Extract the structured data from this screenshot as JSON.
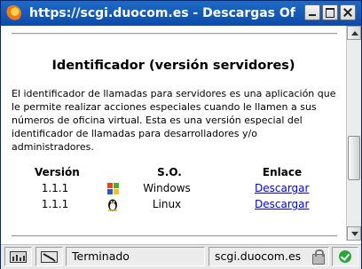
{
  "window": {
    "title": "https://scgi.duocom.es - Descargas Oficina Virtual"
  },
  "page": {
    "heading": "Identificador (versión servidores)",
    "description": "El identificador de llamadas para servidores es una aplicación que le permite realizar acciones especiales cuando le llamen a sus números de oficina virtual. Esta es una versión especial del identificador de llamadas para desarrolladores y/o administradores.",
    "table": {
      "headers": [
        "Versión",
        "S.O.",
        "Enlace"
      ],
      "rows": [
        {
          "version": "1.1.1",
          "os": "Windows",
          "os_icon": "windows-logo-icon",
          "link": "Descargar"
        },
        {
          "version": "1.1.1",
          "os": "Linux",
          "os_icon": "tux-penguin-icon",
          "link": "Descargar"
        }
      ]
    }
  },
  "status_bar": {
    "status_text": "Terminado",
    "host": "scgi.duocom.es",
    "icons": [
      "status-monitor-icon",
      "edit-tool-icon",
      "lock-icon",
      "check-icon"
    ]
  },
  "colors": {
    "titlebar": "#0d4aa8",
    "link": "#0000ee",
    "check": "#2aa63a"
  }
}
